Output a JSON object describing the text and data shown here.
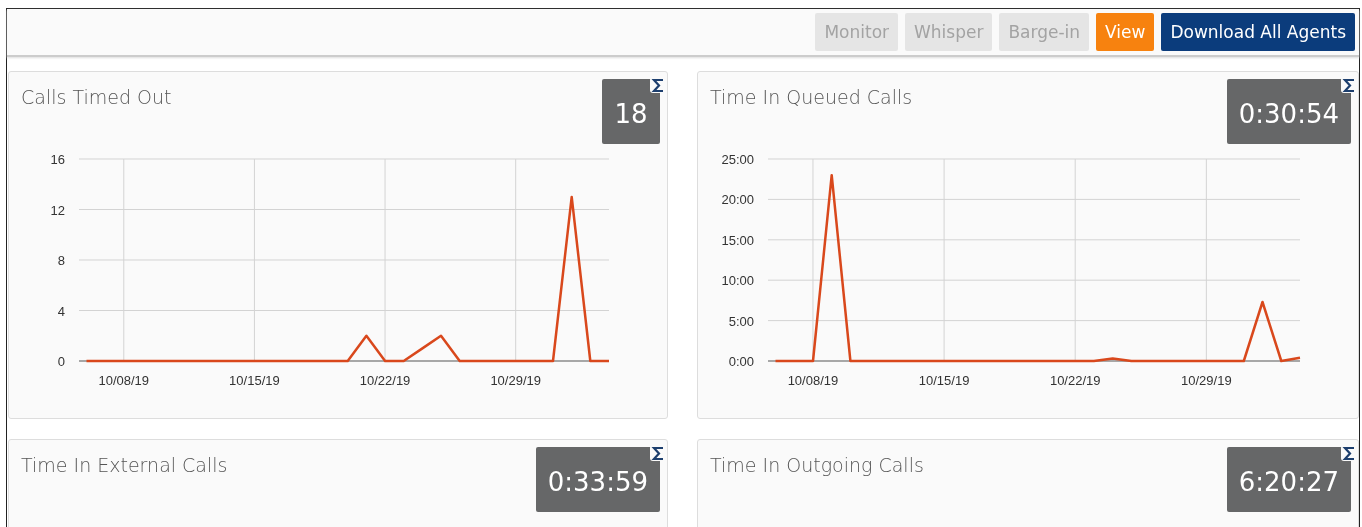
{
  "toolbar": {
    "buttons": [
      {
        "label": "Monitor",
        "disabled": true,
        "kind": "plain"
      },
      {
        "label": "Whisper",
        "disabled": true,
        "kind": "plain"
      },
      {
        "label": "Barge-in",
        "disabled": true,
        "kind": "plain"
      },
      {
        "label": "View",
        "disabled": false,
        "kind": "accent"
      },
      {
        "label": "Download All Agents",
        "disabled": false,
        "kind": "primary"
      }
    ]
  },
  "cards": [
    {
      "title": "Calls Timed Out",
      "total": "18",
      "chart_data": {
        "type": "line",
        "categories": [
          null,
          null,
          "10/08/19",
          null,
          null,
          null,
          null,
          null,
          null,
          "10/15/19",
          null,
          null,
          null,
          null,
          null,
          null,
          "10/22/19",
          null,
          null,
          null,
          null,
          null,
          null,
          "10/29/19",
          null,
          null,
          null,
          null,
          null
        ],
        "ylim": [
          0,
          16
        ],
        "grid": true,
        "yticks": [
          0,
          4,
          8,
          12,
          16
        ],
        "series": [
          {
            "color": "#d9481c",
            "values": [
              0,
              0,
              0,
              0,
              0,
              0,
              0,
              0,
              0,
              0,
              0,
              0,
              0,
              0,
              0,
              2,
              0,
              0,
              1,
              2,
              0,
              0,
              0,
              0,
              0,
              0,
              13,
              0,
              0
            ]
          }
        ]
      }
    },
    {
      "title": "Time In Queued Calls",
      "total": "0:30:54",
      "chart_data": {
        "type": "line",
        "categories": [
          null,
          null,
          "10/08/19",
          null,
          null,
          null,
          null,
          null,
          null,
          "10/15/19",
          null,
          null,
          null,
          null,
          null,
          null,
          "10/22/19",
          null,
          null,
          null,
          null,
          null,
          null,
          "10/29/19",
          null,
          null,
          null,
          null,
          null
        ],
        "ylim": [
          0,
          25
        ],
        "grid": true,
        "yticks": [
          {
            "value": 0,
            "label": "0:00"
          },
          {
            "value": 5,
            "label": "5:00"
          },
          {
            "value": 10,
            "label": "10:00"
          },
          {
            "value": 15,
            "label": "15:00"
          },
          {
            "value": 20,
            "label": "20:00"
          },
          {
            "value": 25,
            "label": "25:00"
          }
        ],
        "series": [
          {
            "color": "#d9481c",
            "values": [
              0,
              0,
              0,
              23,
              0,
              0,
              0,
              0,
              0,
              0,
              0,
              0,
              0,
              0,
              0,
              0,
              0,
              0,
              0.3,
              0,
              0,
              0,
              0,
              0,
              0,
              0,
              7.3,
              0,
              0.4
            ]
          }
        ]
      }
    },
    {
      "title": "Time In External Calls",
      "total": "0:33:59"
    },
    {
      "title": "Time In Outgoing Calls",
      "total": "6:20:27"
    }
  ]
}
